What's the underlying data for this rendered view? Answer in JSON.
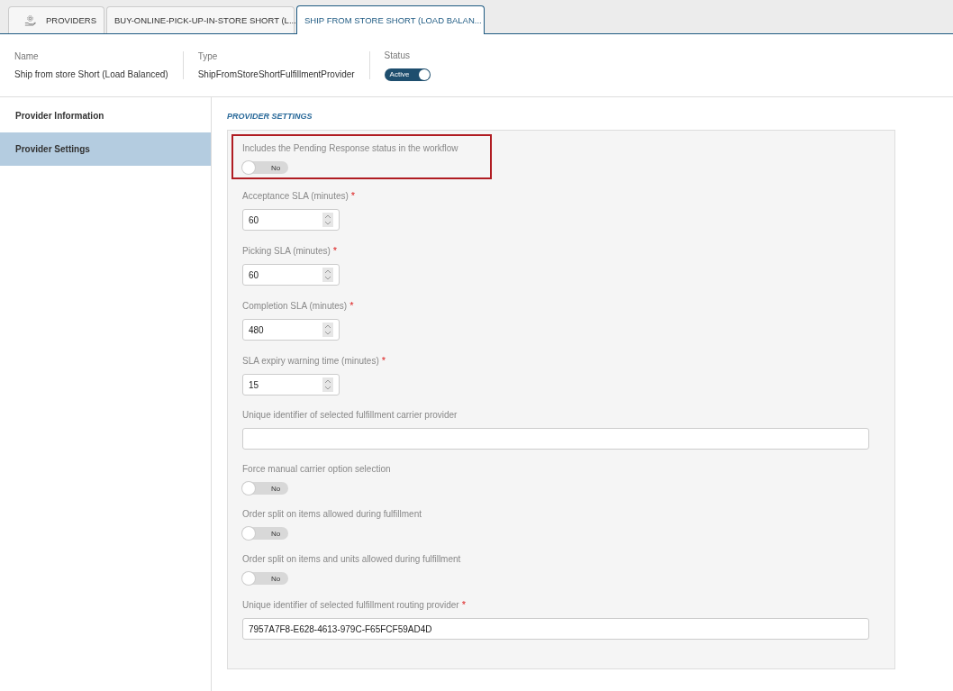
{
  "tabs": [
    {
      "kind": "home",
      "label": "PROVIDERS",
      "selected": false
    },
    {
      "kind": "doc",
      "label": "BUY-ONLINE-PICK-UP-IN-STORE SHORT (L...",
      "selected": false
    },
    {
      "kind": "doc",
      "label": "SHIP FROM STORE SHORT (LOAD BALAN...",
      "selected": true
    }
  ],
  "header": {
    "name_label": "Name",
    "name": "Ship from store Short (Load Balanced)",
    "type_label": "Type",
    "type": "ShipFromStoreShortFulfillmentProvider",
    "status_label": "Status",
    "status": {
      "label": "Active",
      "on": true
    }
  },
  "sidebar": {
    "items": [
      {
        "label": "Provider Information",
        "selected": false
      },
      {
        "label": "Provider Settings",
        "selected": true
      }
    ]
  },
  "settings": {
    "heading": "PROVIDER SETTINGS",
    "fields": [
      {
        "kind": "toggle",
        "label": "Includes the Pending Response status in the workflow",
        "highlighted": true,
        "on": false,
        "value": "No"
      },
      {
        "kind": "number",
        "label": "Acceptance SLA (minutes)",
        "required": "*",
        "value": "60"
      },
      {
        "kind": "number",
        "label": "Picking SLA (minutes)",
        "required": "*",
        "value": "60"
      },
      {
        "kind": "number",
        "label": "Completion SLA (minutes)",
        "required": "*",
        "value": "480"
      },
      {
        "kind": "number",
        "label": "SLA expiry warning time (minutes)",
        "required": "*",
        "value": "15"
      },
      {
        "kind": "text",
        "label": "Unique identifier of selected fulfillment carrier provider"
      },
      {
        "kind": "toggle",
        "label": "Force manual carrier option selection",
        "on": false,
        "value": "No"
      },
      {
        "kind": "toggle",
        "label": "Order split on items allowed during fulfillment",
        "on": false,
        "value": "No"
      },
      {
        "kind": "toggle",
        "label": "Order split on items and units allowed during fulfillment",
        "on": false,
        "value": "No"
      },
      {
        "kind": "text",
        "label": "Unique identifier of selected fulfillment routing provider",
        "required": "*",
        "value": "7957A7F8-E628-4613-979C-F65FCF59AD4D"
      }
    ]
  }
}
